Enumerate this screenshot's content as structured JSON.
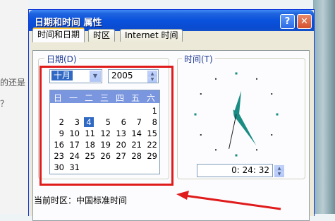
{
  "background": {
    "text_lines": [
      "的还是",
      "？"
    ]
  },
  "window": {
    "title": "日期和时间 属性",
    "help_label": "?",
    "close_label": "✕"
  },
  "tabs": [
    {
      "label": "时间和日期",
      "active": true
    },
    {
      "label": "时区",
      "active": false
    },
    {
      "label": "Internet 时间",
      "active": false
    }
  ],
  "date_group": {
    "label": "日期(D)",
    "month": "十月",
    "year": "2005",
    "weekdays": [
      "日",
      "一",
      "二",
      "三",
      "四",
      "五",
      "六"
    ],
    "days": [
      1,
      2,
      3,
      4,
      5,
      6,
      7,
      8,
      9,
      10,
      11,
      12,
      13,
      14,
      15,
      16,
      17,
      18,
      19,
      20,
      21,
      22,
      23,
      24,
      25,
      26,
      27,
      28,
      29,
      30,
      31
    ],
    "first_weekday": 6,
    "selected_day": 4
  },
  "time_group": {
    "label": "时间(T)",
    "time": "0: 24: 32",
    "hour": 0,
    "minute": 24,
    "second": 32
  },
  "timezone": {
    "label": "当前时区：中国标准时间"
  },
  "colors": {
    "titlebar": "#0a52dc",
    "highlight_box": "#e01b1b",
    "clock_hand": "#1a8c83",
    "selection": "#316ac5"
  }
}
